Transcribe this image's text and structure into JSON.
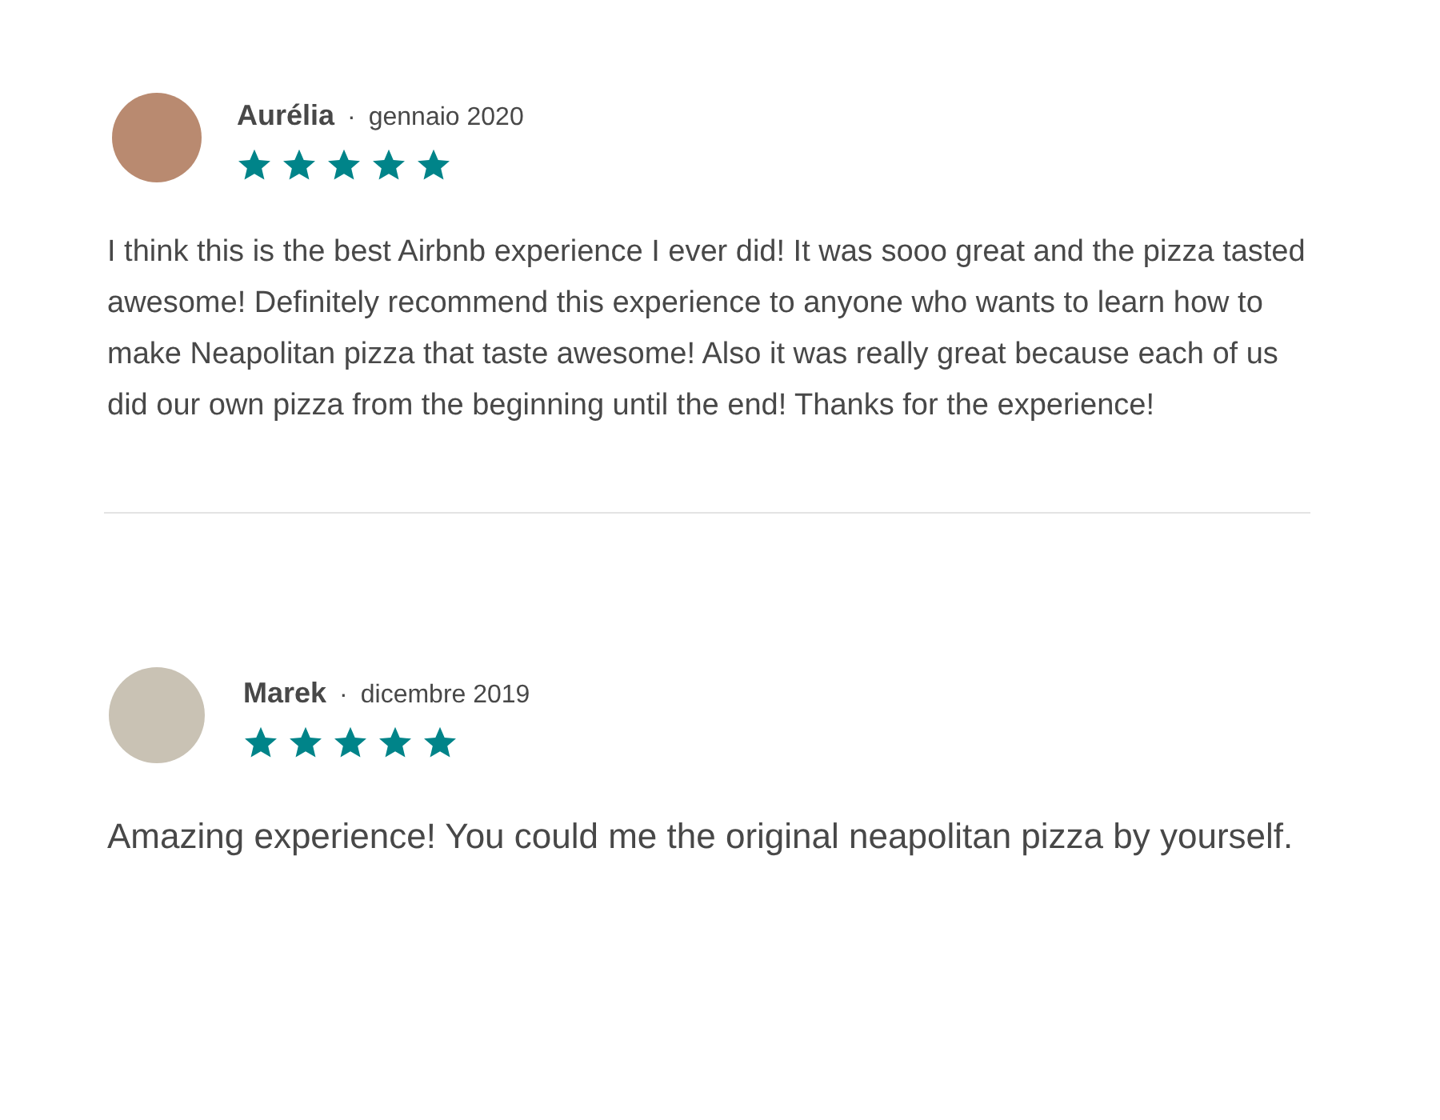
{
  "reviews": [
    {
      "name": "Aurélia",
      "separator": "·",
      "date": "gennaio 2020",
      "stars": 5,
      "text": "I think this is the best Airbnb experience I ever did! It was sooo great and the pizza tasted awesome! Definitely recommend this experience to anyone who wants to learn how to make Neapolitan pizza that taste awesome! Also it was really great because each of us did our own pizza from the beginning until the end! Thanks for the experience!"
    },
    {
      "name": "Marek",
      "separator": "·",
      "date": "dicembre 2019",
      "stars": 5,
      "text": "Amazing experience! You could me the original neapolitan pizza by yourself."
    }
  ]
}
